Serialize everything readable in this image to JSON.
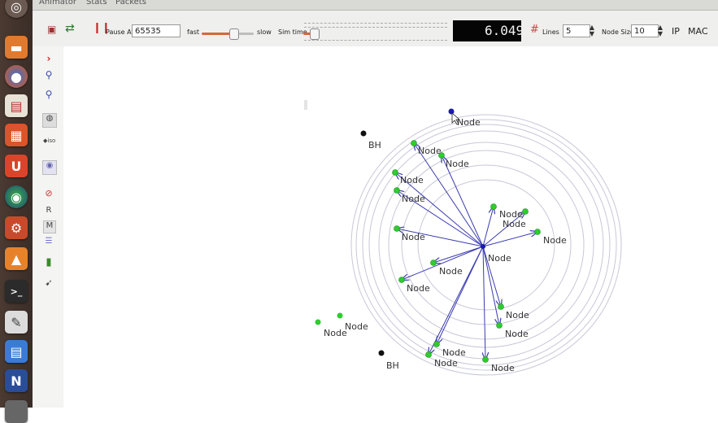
{
  "tabs": [
    "Animator",
    "Stats",
    "Packets"
  ],
  "toolbar": {
    "pause_label": "Pause At",
    "pause_value": "65535",
    "fast_label": "fast",
    "slow_label": "slow",
    "simtime_label": "Sim time",
    "time_display": "6.049",
    "lines_label": "Lines",
    "lines_value": "5",
    "node_size_label": "Node Size",
    "node_size_value": "10",
    "ip_label": "IP",
    "mac_label": "MAC"
  },
  "sidebar": {
    "r_label": "R",
    "m_label": "M"
  },
  "canvas": {
    "node_label": "Node",
    "bh_label": "BH",
    "colors": {
      "node": "#2ecc2e",
      "highlight": "#1a1aa8",
      "bh": "#111111",
      "arrow": "#3b3bb0",
      "ring": "#c8c8d8"
    }
  }
}
